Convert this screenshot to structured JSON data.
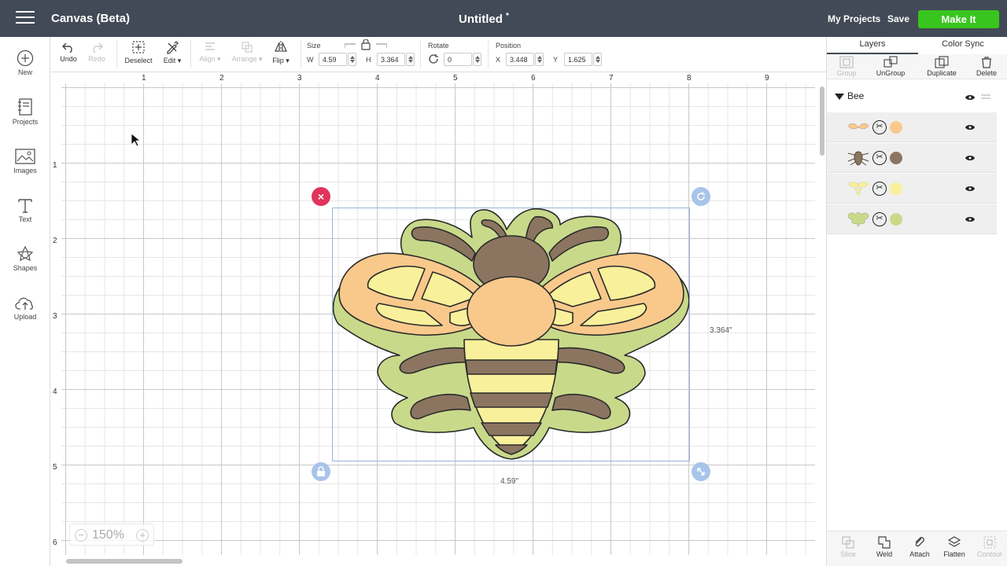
{
  "app": {
    "title": "Canvas (Beta)",
    "doc_title": "Untitled",
    "unsaved_marker": "*"
  },
  "header": {
    "my_projects": "My Projects",
    "save": "Save",
    "make_it": "Make It",
    "make_it_color": "#38c51e"
  },
  "sidebar": {
    "items": [
      {
        "label": "New",
        "icon": "plus-circle-icon"
      },
      {
        "label": "Projects",
        "icon": "notebook-icon"
      },
      {
        "label": "Images",
        "icon": "picture-icon"
      },
      {
        "label": "Text",
        "icon": "text-t-icon"
      },
      {
        "label": "Shapes",
        "icon": "shapes-icon"
      },
      {
        "label": "Upload",
        "icon": "cloud-upload-icon"
      }
    ]
  },
  "toolbar": {
    "undo": "Undo",
    "redo": "Redo",
    "deselect": "Deselect",
    "edit": "Edit",
    "align": "Align",
    "arrange": "Arrange",
    "flip": "Flip",
    "size_label": "Size",
    "w_label": "W",
    "w_value": "4.59",
    "h_label": "H",
    "h_value": "3.364",
    "rotate_label": "Rotate",
    "rotate_value": "0",
    "position_label": "Position",
    "x_label": "X",
    "x_value": "3.448",
    "y_label": "Y",
    "y_value": "1.625"
  },
  "canvas": {
    "ruler_x": [
      "1",
      "2",
      "3",
      "4",
      "5",
      "6",
      "7",
      "8",
      "9"
    ],
    "ruler_y": [
      "1",
      "2",
      "3",
      "4",
      "5",
      "6"
    ],
    "height_label": "3.364\"",
    "width_label": "4.59\"",
    "zoom": "150%",
    "zoom_minus": "−",
    "zoom_plus": "+",
    "delete_glyph": "×",
    "colors": {
      "selection": "#9ab3d8",
      "delete_handle": "#e0345c",
      "handle": "#a8c4e8"
    }
  },
  "layers_panel": {
    "tabs": [
      "Layers",
      "Color Sync"
    ],
    "actions": [
      "Group",
      "UnGroup",
      "Duplicate",
      "Delete"
    ],
    "group_name": "Bee",
    "cut_glyph": "✂",
    "layers": [
      {
        "color": "#f9c98c",
        "icon": "bee-wings-thumb"
      },
      {
        "color": "#8b7560",
        "icon": "bee-body-thumb"
      },
      {
        "color": "#f8f09a",
        "icon": "bee-stripes-thumb"
      },
      {
        "color": "#c9d98a",
        "icon": "bee-outline-thumb"
      }
    ],
    "bottom_actions": [
      "Slice",
      "Weld",
      "Attach",
      "Flatten",
      "Contour"
    ]
  }
}
